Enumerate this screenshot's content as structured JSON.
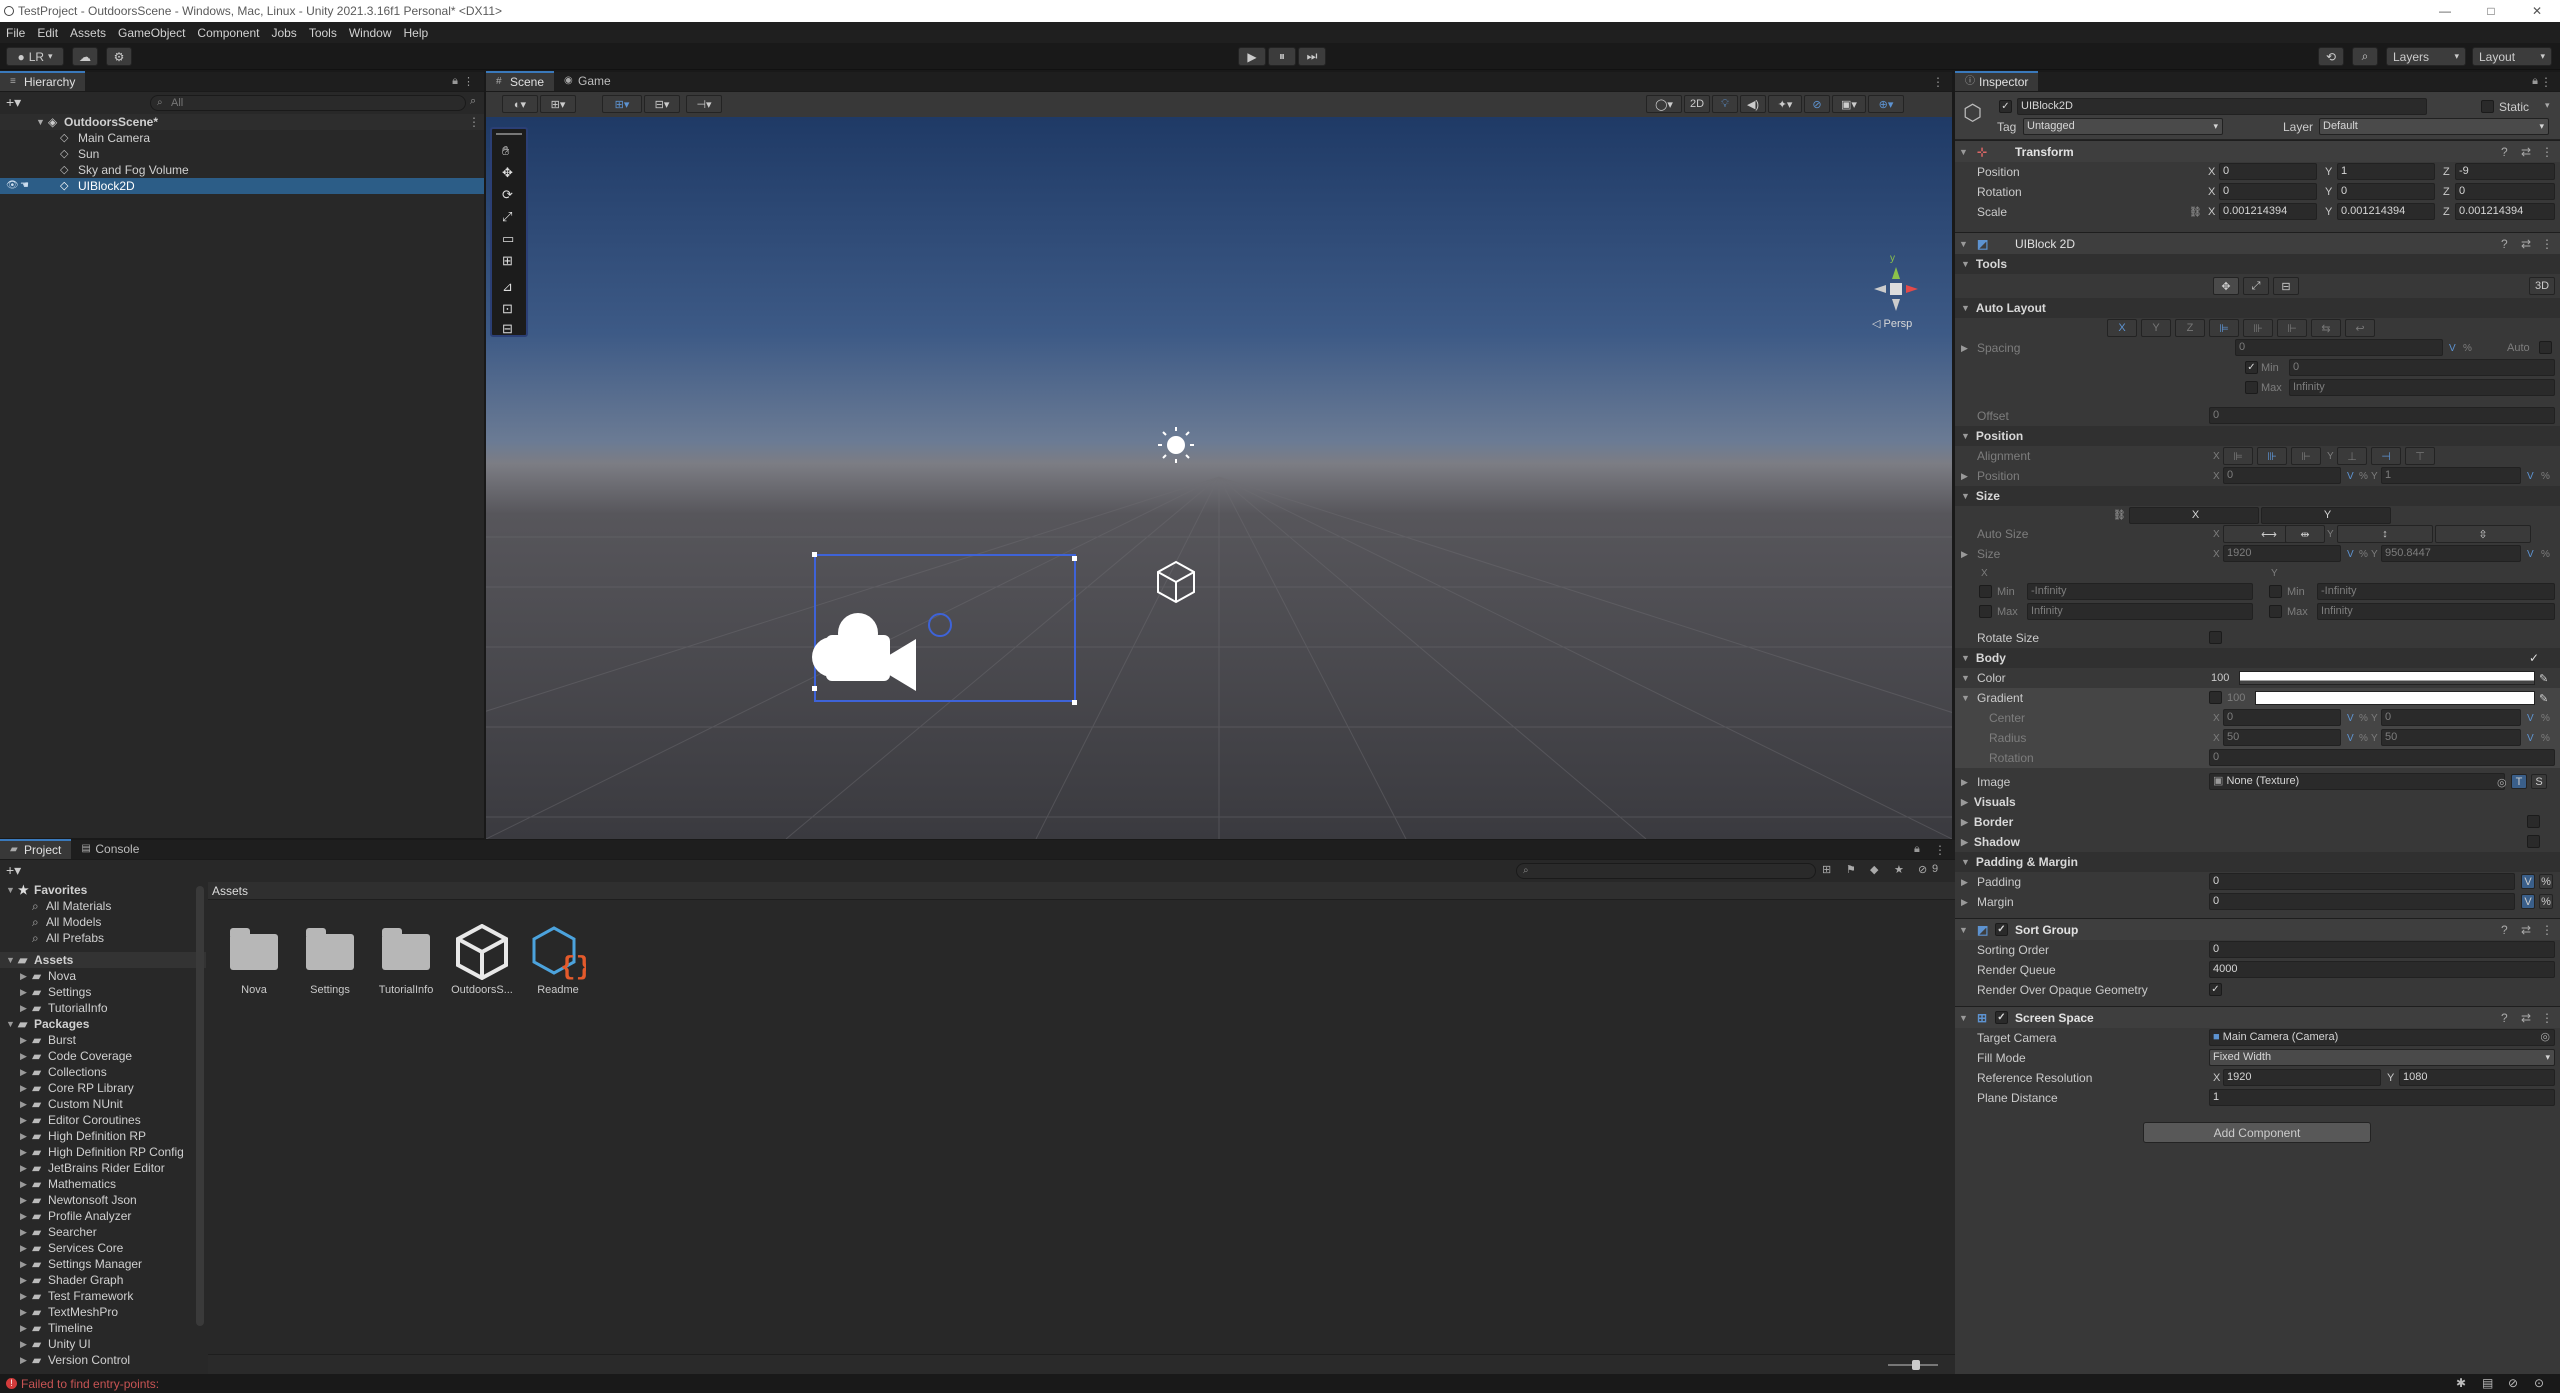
{
  "titlebar": {
    "title": "TestProject - OutdoorsScene - Windows, Mac, Linux - Unity 2021.3.16f1 Personal* <DX11>",
    "minimize": "—",
    "maximize": "□",
    "close": "✕"
  },
  "menu": [
    "File",
    "Edit",
    "Assets",
    "GameObject",
    "Component",
    "Jobs",
    "Tools",
    "Window",
    "Help"
  ],
  "toolbar": {
    "account": "LR",
    "play": "▶",
    "pause": "⏸",
    "step": "⏭",
    "layers": "Layers",
    "layout": "Layout"
  },
  "hierarchy": {
    "tab": "Hierarchy",
    "search_placeholder": "All",
    "scene": "OutdoorsScene*",
    "items": [
      "Main Camera",
      "Sun",
      "Sky and Fog Volume",
      "UIBlock2D"
    ]
  },
  "sceneview": {
    "tabs": [
      "Scene",
      "Game"
    ],
    "mode2d": "2D",
    "persp": "◁ Persp",
    "gizmo_y": "y"
  },
  "project": {
    "tabs": [
      "Project",
      "Console"
    ],
    "favorites_header": "Favorites",
    "favorites": [
      "All Materials",
      "All Models",
      "All Prefabs"
    ],
    "assets_header": "Assets",
    "assets_tree": [
      "Nova",
      "Settings",
      "TutorialInfo"
    ],
    "packages_header": "Packages",
    "packages": [
      "Burst",
      "Code Coverage",
      "Collections",
      "Core RP Library",
      "Custom NUnit",
      "Editor Coroutines",
      "High Definition RP",
      "High Definition RP Config",
      "JetBrains Rider Editor",
      "Mathematics",
      "Newtonsoft Json",
      "Profile Analyzer",
      "Searcher",
      "Services Core",
      "Settings Manager",
      "Shader Graph",
      "Test Framework",
      "TextMeshPro",
      "Timeline",
      "Unity UI",
      "Version Control"
    ],
    "breadcrumb": "Assets",
    "grid": [
      "Nova",
      "Settings",
      "TutorialInfo",
      "OutdoorsS...",
      "Readme"
    ],
    "hidden_count": "9"
  },
  "inspector": {
    "tab": "Inspector",
    "object_name": "UIBlock2D",
    "static_label": "Static",
    "tag_label": "Tag",
    "tag_value": "Untagged",
    "layer_label": "Layer",
    "layer_value": "Default",
    "transform": {
      "title": "Transform",
      "position_label": "Position",
      "rotation_label": "Rotation",
      "scale_label": "Scale",
      "position": [
        "0",
        "1",
        "-9"
      ],
      "rotation": [
        "0",
        "0",
        "0"
      ],
      "scale": [
        "0.001214394",
        "0.001214394",
        "0.001214394"
      ]
    },
    "uiblock": {
      "title": "UIBlock 2D",
      "tools": "Tools",
      "autolayout": "Auto Layout",
      "spacing_label": "Spacing",
      "spacing": "0",
      "auto": "Auto",
      "min_label": "Min",
      "min": "0",
      "max_label": "Max",
      "max": "Infinity",
      "offset_label": "Offset",
      "offset": "0",
      "position_hdr": "Position",
      "alignment_label": "Alignment",
      "pos_label": "Position",
      "pos_x": "0",
      "pos_y": "1",
      "size_hdr": "Size",
      "autosize_label": "Auto Size",
      "size_label": "Size",
      "size_x": "1920",
      "size_y": "950.8447",
      "min_neg": "-Infinity",
      "max_inf": "Infinity",
      "rotate_size": "Rotate Size",
      "body": "Body",
      "color_label": "Color",
      "color_val": "100",
      "gradient_label": "Gradient",
      "gradient_val": "100",
      "center_label": "Center",
      "center_x": "0",
      "center_y": "0",
      "radius_label": "Radius",
      "radius_x": "50",
      "radius_y": "50",
      "rotation_label": "Rotation",
      "rotation_val": "0",
      "image_label": "Image",
      "image_val": "None (Texture)",
      "visuals": "Visuals",
      "border": "Border",
      "shadow": "Shadow",
      "padmargin": "Padding & Margin",
      "padding_label": "Padding",
      "padding": "0",
      "margin_label": "Margin",
      "margin": "0",
      "V": "V",
      "pct": "%",
      "X": "X",
      "Y": "Y",
      "Z": "Z"
    },
    "sortgroup": {
      "title": "Sort Group",
      "sorting_order_label": "Sorting Order",
      "sorting_order": "0",
      "render_queue_label": "Render Queue",
      "render_queue": "4000",
      "render_over_label": "Render Over Opaque Geometry"
    },
    "screenspace": {
      "title": "Screen Space",
      "target_camera_label": "Target Camera",
      "target_camera": "Main Camera (Camera)",
      "fill_mode_label": "Fill Mode",
      "fill_mode": "Fixed Width",
      "ref_res_label": "Reference Resolution",
      "ref_x": "1920",
      "ref_y": "1080",
      "plane_distance_label": "Plane Distance",
      "plane_distance": "1"
    },
    "add_component": "Add Component"
  },
  "status": {
    "error": "Failed to find entry-points:"
  }
}
